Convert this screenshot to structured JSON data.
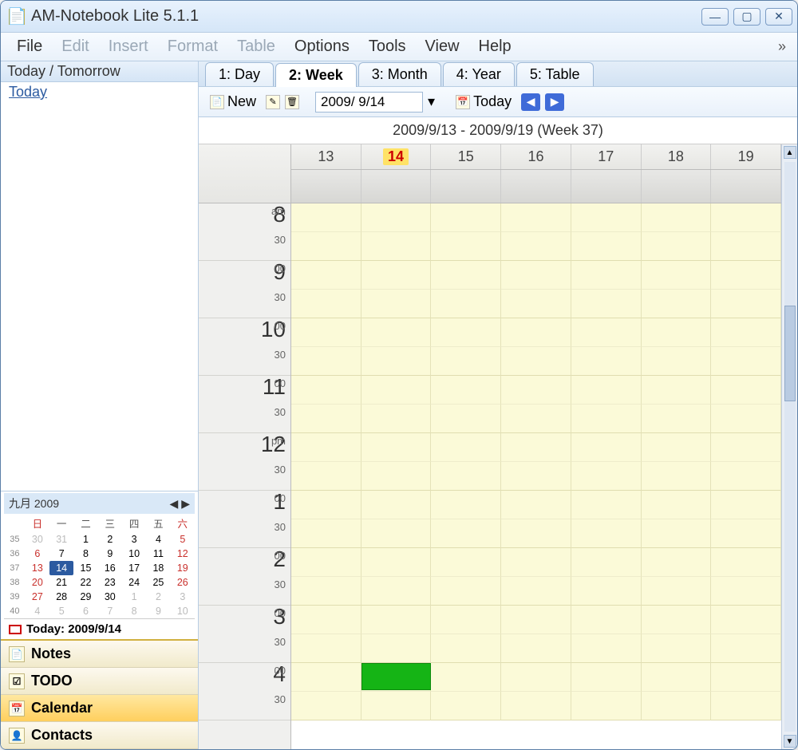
{
  "app": {
    "title": "AM-Notebook Lite  5.1.1"
  },
  "menu": {
    "file": "File",
    "edit": "Edit",
    "insert": "Insert",
    "format": "Format",
    "table": "Table",
    "options": "Options",
    "tools": "Tools",
    "view": "View",
    "help": "Help"
  },
  "sidebar": {
    "header": "Today / Tomorrow",
    "today_link": "Today",
    "minical": {
      "month_label": "九月 2009",
      "dow": [
        "日",
        "一",
        "二",
        "三",
        "四",
        "五",
        "六"
      ],
      "weeks": [
        {
          "wk": "35",
          "days": [
            {
              "d": "30",
              "dim": true
            },
            {
              "d": "31",
              "dim": true
            },
            {
              "d": "1"
            },
            {
              "d": "2"
            },
            {
              "d": "3"
            },
            {
              "d": "4"
            },
            {
              "d": "5",
              "sat": true
            }
          ]
        },
        {
          "wk": "36",
          "days": [
            {
              "d": "6",
              "sun": true
            },
            {
              "d": "7"
            },
            {
              "d": "8"
            },
            {
              "d": "9"
            },
            {
              "d": "10"
            },
            {
              "d": "11"
            },
            {
              "d": "12",
              "sat": true
            }
          ]
        },
        {
          "wk": "37",
          "days": [
            {
              "d": "13",
              "sun": true
            },
            {
              "d": "14",
              "today": true
            },
            {
              "d": "15"
            },
            {
              "d": "16"
            },
            {
              "d": "17"
            },
            {
              "d": "18"
            },
            {
              "d": "19",
              "sat": true
            }
          ]
        },
        {
          "wk": "38",
          "days": [
            {
              "d": "20",
              "sun": true
            },
            {
              "d": "21"
            },
            {
              "d": "22"
            },
            {
              "d": "23"
            },
            {
              "d": "24"
            },
            {
              "d": "25"
            },
            {
              "d": "26",
              "sat": true
            }
          ]
        },
        {
          "wk": "39",
          "days": [
            {
              "d": "27",
              "sun": true
            },
            {
              "d": "28"
            },
            {
              "d": "29"
            },
            {
              "d": "30"
            },
            {
              "d": "1",
              "dim": true
            },
            {
              "d": "2",
              "dim": true
            },
            {
              "d": "3",
              "dim": true
            }
          ]
        },
        {
          "wk": "40",
          "days": [
            {
              "d": "4",
              "dim": true
            },
            {
              "d": "5",
              "dim": true
            },
            {
              "d": "6",
              "dim": true
            },
            {
              "d": "7",
              "dim": true
            },
            {
              "d": "8",
              "dim": true
            },
            {
              "d": "9",
              "dim": true
            },
            {
              "d": "10",
              "dim": true
            }
          ]
        }
      ],
      "today_footer": "Today: 2009/9/14"
    },
    "nav": {
      "notes": "Notes",
      "todo": "TODO",
      "calendar": "Calendar",
      "contacts": "Contacts"
    }
  },
  "view_tabs": {
    "day": "1: Day",
    "week": "2: Week",
    "month": "3: Month",
    "year": "4: Year",
    "table": "5: Table"
  },
  "toolbar": {
    "new_label": "New",
    "date_value": "2009/ 9/14",
    "today_label": "Today"
  },
  "week": {
    "range_label": "2009/9/13  -  2009/9/19   (Week 37)",
    "day_heads": [
      "13",
      "14",
      "15",
      "16",
      "17",
      "18",
      "19"
    ],
    "today_index": 1,
    "hours": [
      {
        "h": "8",
        "top": "am",
        "bottom": "30"
      },
      {
        "h": "9",
        "top": "00",
        "bottom": "30"
      },
      {
        "h": "10",
        "top": "00",
        "bottom": "30"
      },
      {
        "h": "11",
        "top": "00",
        "bottom": "30"
      },
      {
        "h": "12",
        "top": "pm",
        "bottom": "30"
      },
      {
        "h": "1",
        "top": "00",
        "bottom": "30"
      },
      {
        "h": "2",
        "top": "00",
        "bottom": "30"
      },
      {
        "h": "3",
        "top": "00",
        "bottom": "30"
      },
      {
        "h": "4",
        "top": "00",
        "bottom": "30"
      }
    ],
    "event": {
      "day_index": 1,
      "hour_row": 8,
      "half": 0
    }
  }
}
